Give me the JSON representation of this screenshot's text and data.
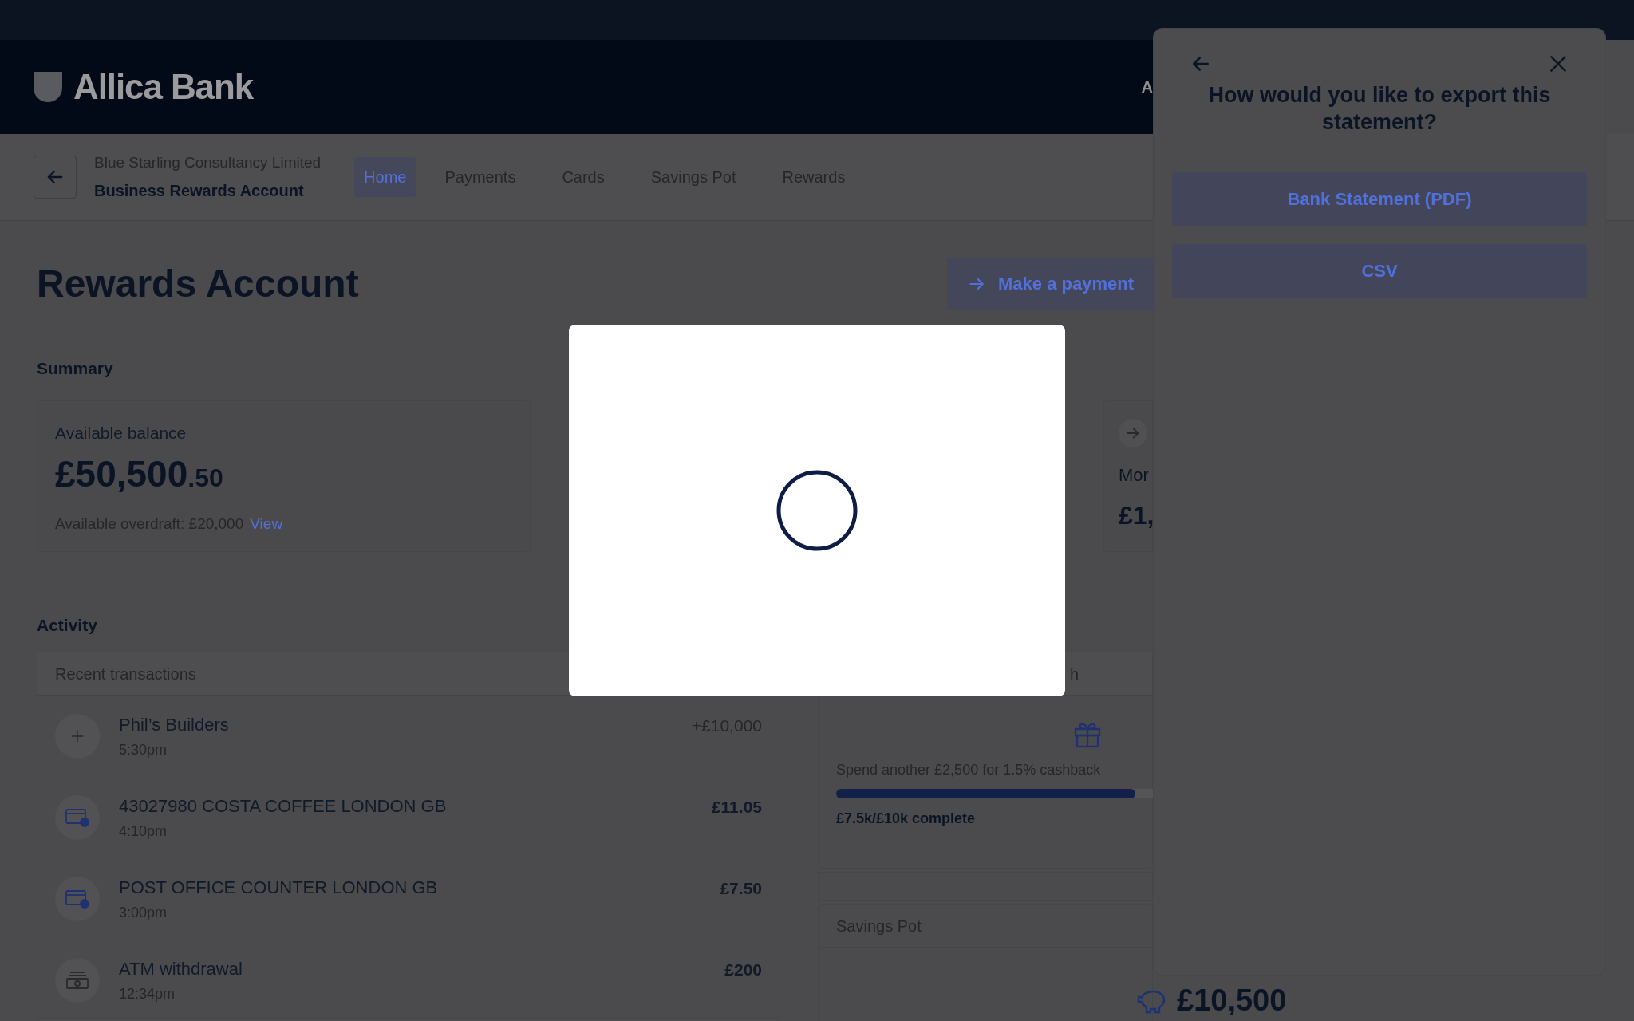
{
  "header": {
    "logo": "Allica Bank",
    "nav_fragment": "A"
  },
  "account": {
    "company": "Blue Starling Consultancy Limited",
    "name": "Business Rewards Account"
  },
  "tabs": [
    {
      "label": "Home",
      "selected": true
    },
    {
      "label": "Payments",
      "selected": false
    },
    {
      "label": "Cards",
      "selected": false
    },
    {
      "label": "Savings Pot",
      "selected": false
    },
    {
      "label": "Rewards",
      "selected": false
    }
  ],
  "page_title": "Rewards Account",
  "make_payment": "Make a payment",
  "summary": {
    "heading": "Summary",
    "balance_label": "Available balance",
    "balance_main": "£50,500",
    "balance_pence": ".50",
    "overdraft": "Available overdraft: £20,000",
    "overdraft_link": "View"
  },
  "summary_card_2": {
    "label": "Mor",
    "value": "£1,"
  },
  "activity": {
    "heading": "Activity",
    "transactions_title": "Recent transactions",
    "transactions": [
      {
        "kind": "credit",
        "name": "Phil’s Builders",
        "time": "5:30pm",
        "amount": "+£10,000"
      },
      {
        "kind": "card",
        "name": "43027980 COSTA COFFEE LONDON GB",
        "time": "4:10pm",
        "amount": "£11.05"
      },
      {
        "kind": "card",
        "name": "POST OFFICE COUNTER LONDON GB",
        "time": "3:00pm",
        "amount": "£7.50"
      },
      {
        "kind": "atm",
        "name": "ATM withdrawal",
        "time": "12:34pm",
        "amount": "£200"
      }
    ]
  },
  "rewards": {
    "heading": "h",
    "progress_text": "Spend another £2,500 for 1.5% cashback",
    "level": 0.75,
    "progress_label": "£7.5k/£10k complete"
  },
  "savings_pot": {
    "title": "Savings Pot",
    "balance": "£10,500"
  },
  "export_drawer": {
    "title": "How would you like to export this statement?",
    "options": [
      "Bank Statement (PDF)",
      "CSV"
    ]
  }
}
